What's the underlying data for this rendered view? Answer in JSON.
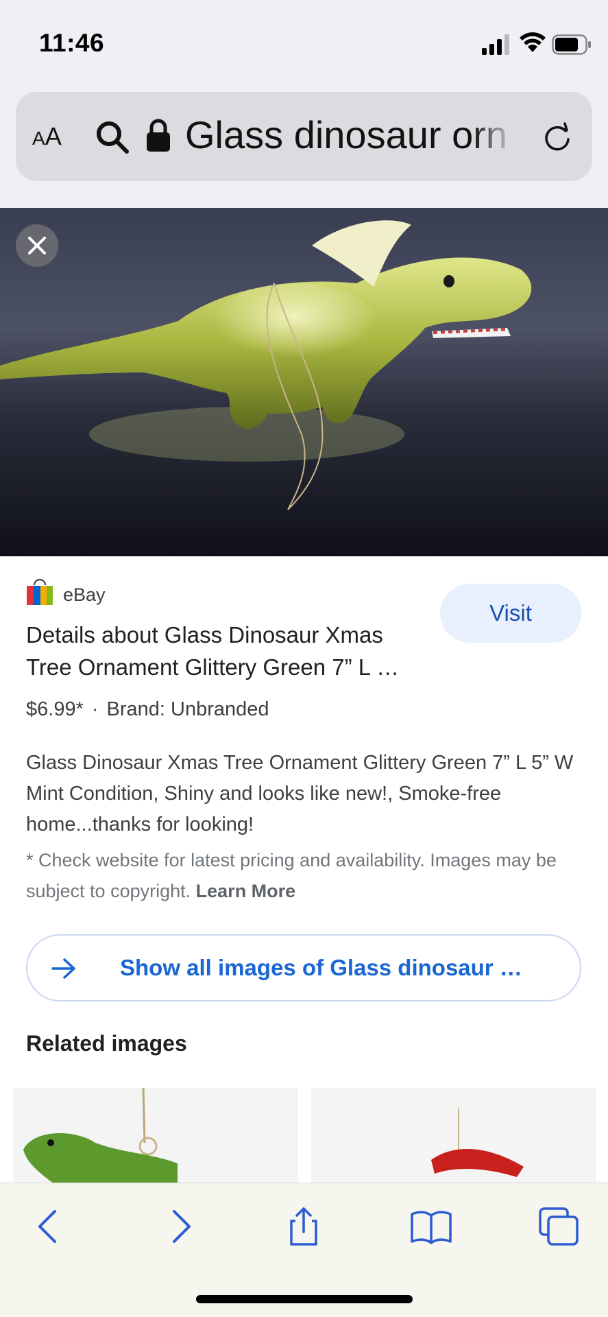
{
  "status_bar": {
    "time": "11:46"
  },
  "url_bar": {
    "text_size_label": "AA",
    "url_text": "Glass dinosaur ornament"
  },
  "result": {
    "source_name": "eBay",
    "visit_label": "Visit",
    "title": "Details about Glass Dinosaur Xmas Tree Ornament Glittery Green 7” L …",
    "price": "$6.99*",
    "separator": "·",
    "brand": "Brand: Unbranded",
    "description": "Glass Dinosaur Xmas Tree Ornament Glittery Green 7” L 5” W Mint Condition, Shiny and looks like new!, Smoke-free home...thanks for looking!",
    "disclaimer": "* Check website for latest pricing and availability. Images may be subject to copyright.",
    "learn_more": "Learn More"
  },
  "show_all_label": "Show all images of Glass dinosaur …",
  "related_heading": "Related images",
  "colors": {
    "accent_blue": "#1a66d2",
    "visit_bg": "#e8f0fe",
    "chrome_bg": "#efeff4"
  },
  "icons": [
    "signal-icon",
    "wifi-icon",
    "battery-icon",
    "search-icon",
    "lock-icon",
    "reload-icon",
    "close-icon",
    "ebay-logo-icon",
    "arrow-right-icon",
    "back-icon",
    "forward-icon",
    "share-icon",
    "bookmarks-icon",
    "tabs-icon"
  ]
}
